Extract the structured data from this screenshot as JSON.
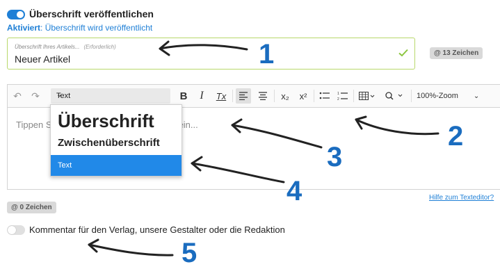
{
  "publish": {
    "toggle_label": "Überschrift veröffentlichen",
    "status_prefix": "Aktiviert",
    "status_text": ": Überschrift wird veröffentlicht"
  },
  "title_field": {
    "placeholder": "Überschrift Ihres Artikels...",
    "required": "(Erforderlich)",
    "value": "Neuer Artikel",
    "char_count": "@ 13 Zeichen"
  },
  "editor": {
    "style_select_value": "Text",
    "zoom_label": "100%-Zoom",
    "placeholder_start": "Tippen S",
    "placeholder_end": "ein...",
    "char_count": "@ 0 Zeichen",
    "help_link": "Hilfe zum Texteditor?"
  },
  "toolbar_buttons": {
    "bold": "B",
    "italic": "I",
    "clear_format": "Tx",
    "subscript": "x₂",
    "superscript": "x²"
  },
  "dropdown": {
    "items": [
      "Überschrift",
      "Zwischenüberschrift",
      "Text"
    ],
    "selected": "Text"
  },
  "comment": {
    "toggle_label": "Kommentar für den Verlag, unsere Gestalter oder die Redaktion"
  },
  "annotations": [
    "1",
    "2",
    "3",
    "4",
    "5"
  ],
  "colors": {
    "accent": "#1e7fd6",
    "annotation": "#1a6cbf",
    "valid_border": "#b8d86a",
    "check": "#8cc63f",
    "selected_item": "#2189e8"
  }
}
